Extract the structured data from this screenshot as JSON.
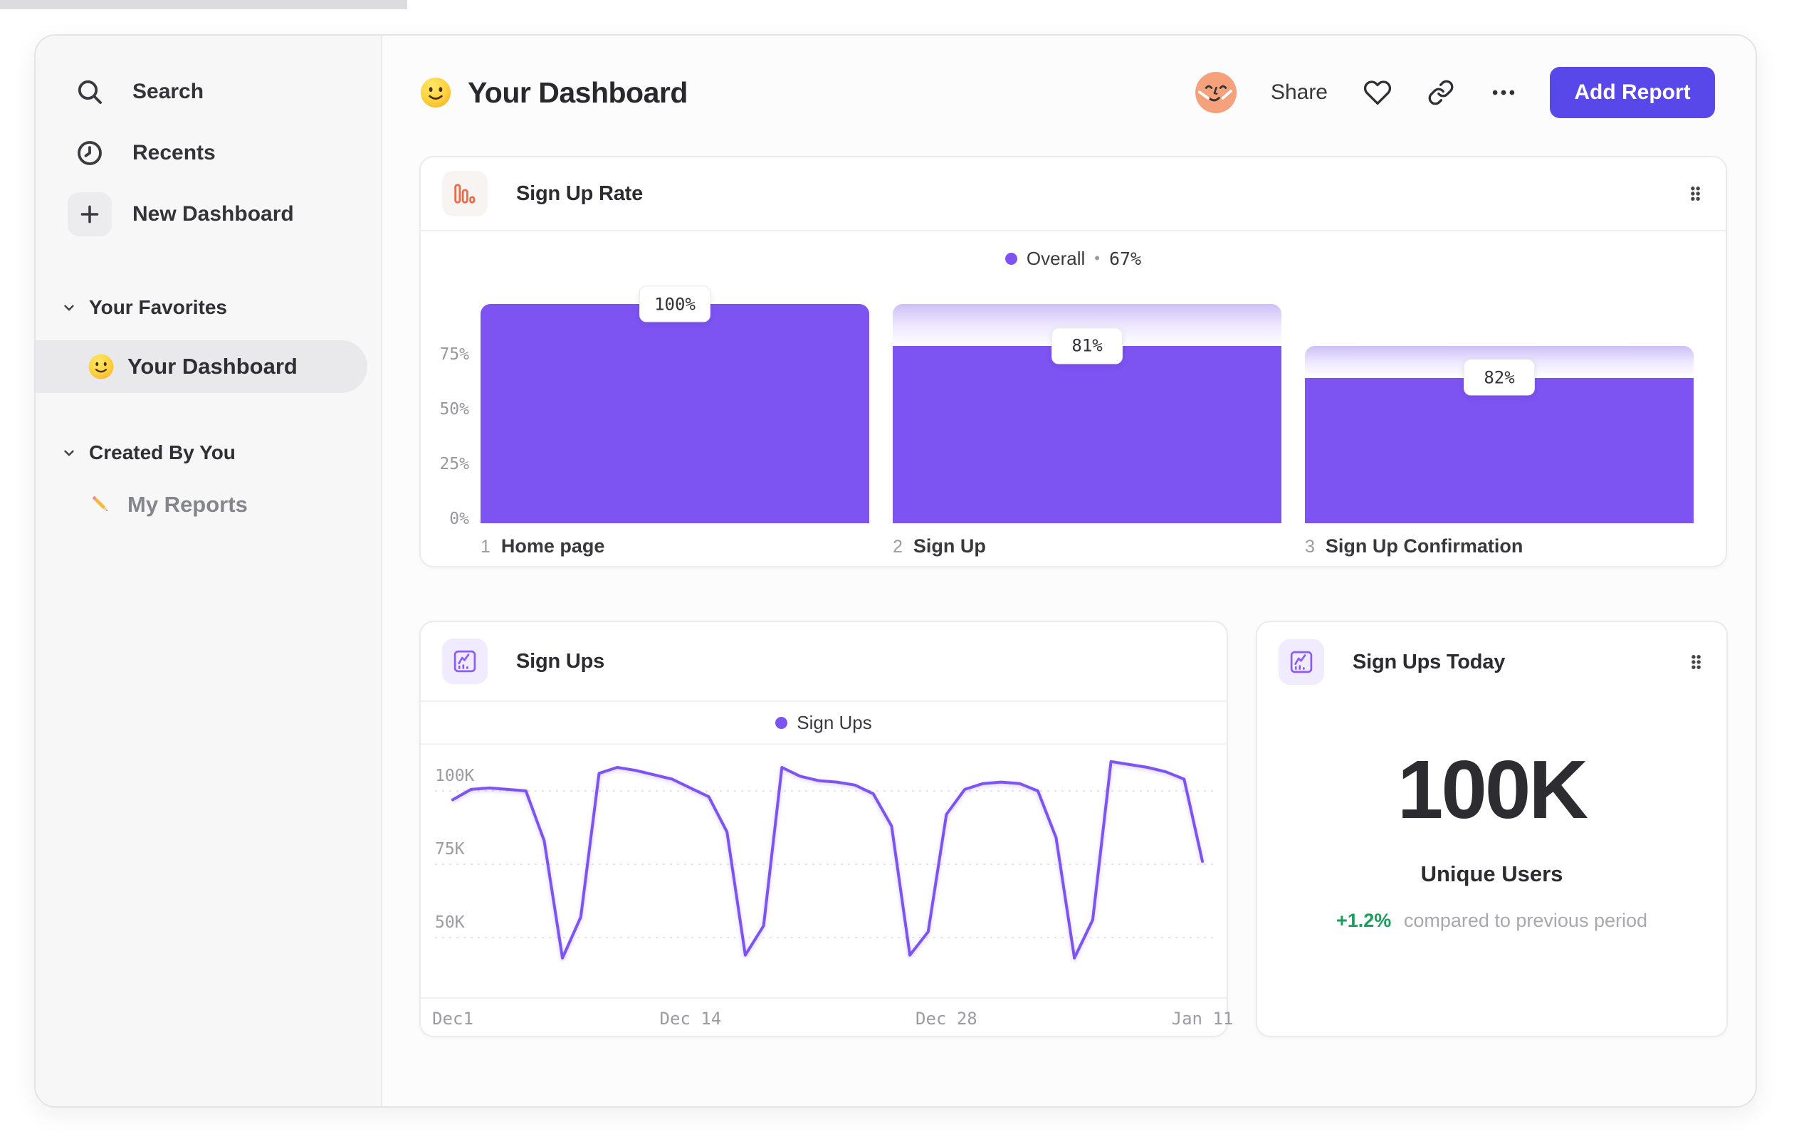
{
  "colors": {
    "accent_purple": "#7d53f2",
    "button_indigo": "#5847e9",
    "gradient_cap_top": "#cdbff7",
    "green_positive": "#16a05a",
    "funnel_icon_orange": "#ed6a49",
    "line_icon_purple": "#8b5cf6"
  },
  "sidebar": {
    "nav": [
      {
        "icon": "search-icon",
        "label": "Search"
      },
      {
        "icon": "clock-icon",
        "label": "Recents"
      },
      {
        "icon": "plus-icon",
        "label": "New Dashboard"
      }
    ],
    "sections": [
      {
        "label": "Your Favorites",
        "items": [
          {
            "icon": "smiley-emoji",
            "label": "Your Dashboard",
            "selected": true
          }
        ]
      },
      {
        "label": "Created By You",
        "items": [
          {
            "icon": "pencil-emoji",
            "label": "My Reports",
            "selected": false
          }
        ]
      }
    ]
  },
  "header": {
    "emoji": "smiley",
    "title": "Your Dashboard",
    "share_label": "Share",
    "add_report_label": "Add Report"
  },
  "cards": {
    "funnel": {
      "title": "Sign Up Rate",
      "legend_label": "Overall",
      "legend_sep": "•",
      "legend_value": "67%"
    },
    "line": {
      "title": "Sign Ups",
      "legend_label": "Sign Ups"
    },
    "metric": {
      "title": "Sign Ups Today",
      "value": "100K",
      "caption": "Unique Users",
      "delta": "+1.2%",
      "delta_note": "compared to previous period"
    }
  },
  "chart_data": [
    {
      "type": "bar",
      "subtype": "funnel",
      "title": "Sign Up Rate",
      "legend": [
        {
          "name": "Overall",
          "value": "67%"
        }
      ],
      "legend_position": "top-center",
      "ylim": [
        0,
        100
      ],
      "y_ticks": [
        {
          "label": "75%",
          "v": 75
        },
        {
          "label": "50%",
          "v": 50
        },
        {
          "label": "25%",
          "v": 25
        },
        {
          "label": "0%",
          "v": 0
        }
      ],
      "steps": [
        {
          "step": 1,
          "label": "Home page",
          "absolute_pct": 100,
          "conversion_from_prev_pct": 100,
          "badge": "100%"
        },
        {
          "step": 2,
          "label": "Sign Up",
          "absolute_pct": 81,
          "conversion_from_prev_pct": 81,
          "badge": "81%"
        },
        {
          "step": 3,
          "label": "Sign Up Confirmation",
          "absolute_pct": 66.4,
          "conversion_from_prev_pct": 82,
          "badge": "82%"
        }
      ]
    },
    {
      "type": "line",
      "title": "Sign Ups",
      "legend": [
        "Sign Ups"
      ],
      "legend_position": "top-center",
      "grid": "dashed-horizontal",
      "unit": "thousands of users per day",
      "ylim": [
        40,
        112
      ],
      "y_ticks": [
        {
          "label": "100K",
          "v": 100
        },
        {
          "label": "75K",
          "v": 75
        },
        {
          "label": "50K",
          "v": 50
        }
      ],
      "x_ticks": [
        {
          "label": "Dec1",
          "i": 0
        },
        {
          "label": "Dec 14",
          "i": 13
        },
        {
          "label": "Dec 28",
          "i": 27
        },
        {
          "label": "Jan 11",
          "i": 41
        }
      ],
      "series": [
        {
          "name": "Sign Ups",
          "values_k": [
            97,
            100.5,
            101,
            100.5,
            100,
            83,
            43,
            57,
            106,
            108,
            107,
            105.5,
            104,
            101,
            98,
            86,
            44,
            54,
            108,
            105,
            103.5,
            103,
            102,
            99,
            88,
            44,
            52,
            92,
            100.5,
            102.5,
            103,
            102.5,
            100,
            84,
            43,
            56,
            110,
            109,
            108,
            106.5,
            104,
            76
          ]
        }
      ]
    }
  ]
}
